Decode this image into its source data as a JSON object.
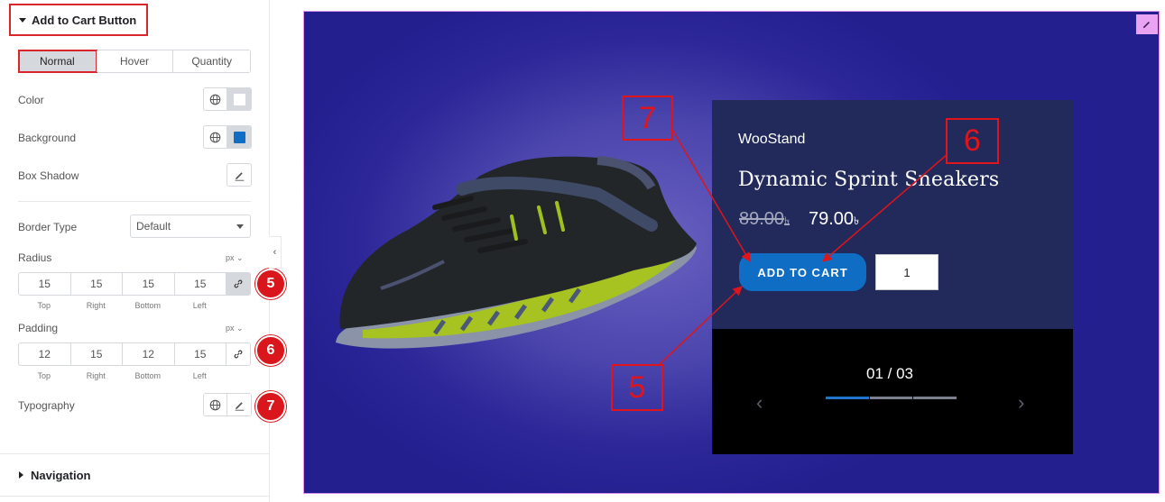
{
  "panel": {
    "section_title": "Add to Cart Button",
    "tabs": [
      {
        "label": "Normal",
        "active": true
      },
      {
        "label": "Hover",
        "active": false
      },
      {
        "label": "Quantity",
        "active": false
      }
    ],
    "color_label": "Color",
    "color_value": "#ffffff",
    "background_label": "Background",
    "background_value": "#0f6ec4",
    "box_shadow_label": "Box Shadow",
    "border_type_label": "Border Type",
    "border_type_value": "Default",
    "radius_label": "Radius",
    "radius_unit": "px",
    "radius_values": [
      "15",
      "15",
      "15",
      "15"
    ],
    "padding_label": "Padding",
    "padding_unit": "px",
    "padding_values": [
      "12",
      "15",
      "12",
      "15"
    ],
    "dim_labels": [
      "Top",
      "Right",
      "Bottom",
      "Left"
    ],
    "typography_label": "Typography",
    "navigation_title": "Navigation",
    "badges": [
      "5",
      "6",
      "7"
    ]
  },
  "preview": {
    "brand": "WooStand",
    "product_title": "Dynamic Sprint Sneakers",
    "price_old": "89.00",
    "price_new": "79.00",
    "currency_symbol": "৳",
    "cart_button_label": "ADD TO CART",
    "quantity": "1",
    "slide_counter": "01 / 03",
    "prev_arrow": "‹",
    "next_arrow": "›",
    "slide_progress": {
      "current": 1,
      "total": 3
    },
    "callouts": [
      "7",
      "6",
      "5"
    ]
  },
  "colors": {
    "accent_red": "#d8161b",
    "button_blue": "#0f6ec4",
    "card_navy": "#222a5b",
    "backdrop_purple": "#2d2799"
  }
}
